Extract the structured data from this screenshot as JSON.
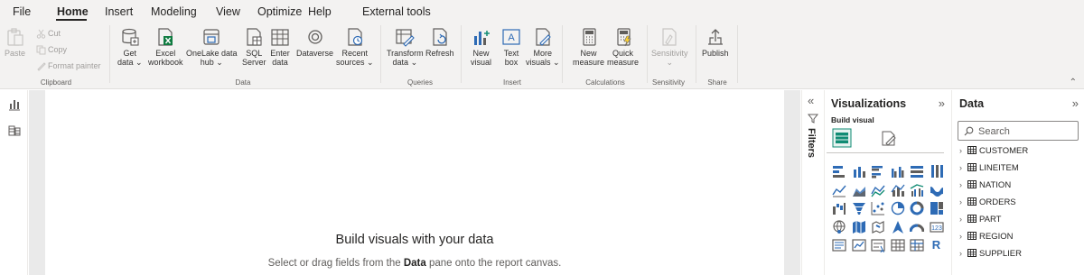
{
  "menu": {
    "tabs": [
      {
        "label": "File"
      },
      {
        "label": "Home"
      },
      {
        "label": "Insert"
      },
      {
        "label": "Modeling"
      },
      {
        "label": "View"
      },
      {
        "label": "Optimize"
      },
      {
        "label": "Help"
      },
      {
        "label": "External tools"
      }
    ],
    "active_tab": "Home"
  },
  "ribbon": {
    "clipboard": {
      "paste": "Paste",
      "cut": "Cut",
      "copy": "Copy",
      "format_painter": "Format painter",
      "group_label": "Clipboard"
    },
    "data": {
      "get_data": {
        "line1": "Get",
        "line2": "data ⌄"
      },
      "excel": {
        "line1": "Excel",
        "line2": "workbook"
      },
      "onelake": {
        "line1": "OneLake data",
        "line2": "hub ⌄"
      },
      "sql": {
        "line1": "SQL",
        "line2": "Server"
      },
      "enter_data": {
        "line1": "Enter",
        "line2": "data"
      },
      "dataverse": {
        "line1": "Dataverse",
        "line2": ""
      },
      "recent": {
        "line1": "Recent",
        "line2": "sources ⌄"
      },
      "group_label": "Data"
    },
    "queries": {
      "transform": {
        "line1": "Transform",
        "line2": "data ⌄"
      },
      "refresh": {
        "line1": "Refresh",
        "line2": ""
      },
      "group_label": "Queries"
    },
    "insert": {
      "new_visual": {
        "line1": "New",
        "line2": "visual"
      },
      "text_box": {
        "line1": "Text",
        "line2": "box"
      },
      "more_visuals": {
        "line1": "More",
        "line2": "visuals ⌄"
      },
      "group_label": "Insert"
    },
    "calculations": {
      "new_measure": {
        "line1": "New",
        "line2": "measure"
      },
      "quick_measure": {
        "line1": "Quick",
        "line2": "measure"
      },
      "group_label": "Calculations"
    },
    "sensitivity": {
      "button": {
        "line1": "Sensitivity",
        "line2": "⌄"
      },
      "group_label": "Sensitivity"
    },
    "share": {
      "publish": {
        "line1": "Publish",
        "line2": ""
      },
      "group_label": "Share"
    }
  },
  "canvas": {
    "title": "Build visuals with your data",
    "subtitle_pre": "Select or drag fields from the ",
    "subtitle_bold": "Data",
    "subtitle_post": " pane onto the report canvas."
  },
  "filters": {
    "label": "Filters"
  },
  "visualizations": {
    "title": "Visualizations",
    "build_visual": "Build visual",
    "icons": [
      "stacked-bar-chart-icon",
      "stacked-column-chart-icon",
      "clustered-bar-chart-icon",
      "clustered-column-chart-icon",
      "100-stacked-bar-chart-icon",
      "100-stacked-column-chart-icon",
      "line-chart-icon",
      "area-chart-icon",
      "stacked-area-chart-icon",
      "line-and-column-chart-icon",
      "line-and-clustered-column-chart-icon",
      "ribbon-chart-icon",
      "waterfall-chart-icon",
      "funnel-icon",
      "scatter-chart-icon",
      "pie-chart-icon",
      "donut-chart-icon",
      "treemap-icon",
      "map-icon",
      "filled-map-icon",
      "shape-map-icon",
      "azure-map-icon",
      "gauge-icon",
      "card-icon",
      "multi-row-card-icon",
      "kpi-icon",
      "slicer-icon",
      "table-icon",
      "matrix-icon",
      "r-visual-icon"
    ],
    "r_letter": "R"
  },
  "data_pane": {
    "title": "Data",
    "search_placeholder": "Search",
    "tables": [
      {
        "name": "CUSTOMER"
      },
      {
        "name": "LINEITEM"
      },
      {
        "name": "NATION"
      },
      {
        "name": "ORDERS"
      },
      {
        "name": "PART"
      },
      {
        "name": "REGION"
      },
      {
        "name": "SUPPLIER"
      }
    ]
  },
  "colors": {
    "accent_green": "#118c74",
    "icon_blue": "#2e6bb5",
    "icon_gray": "#605e5c",
    "ribbon_bg": "#f3f2f1",
    "canvas_bg": "#eaeaea",
    "excel_green": "#107c41"
  }
}
